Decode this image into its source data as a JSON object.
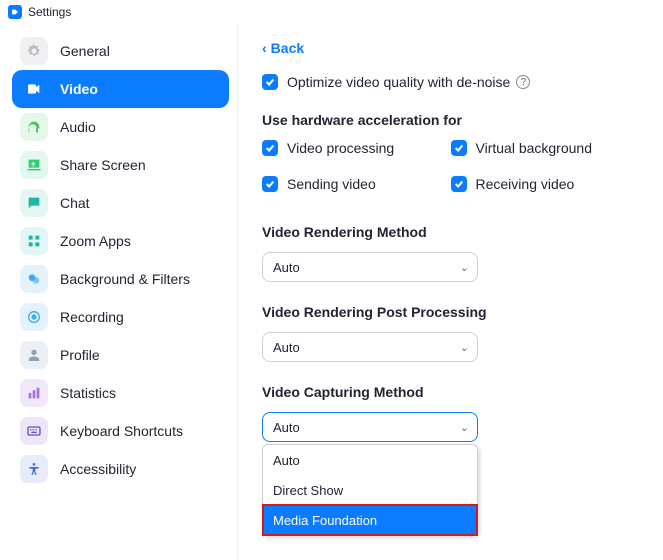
{
  "window": {
    "title": "Settings"
  },
  "sidebar": {
    "items": [
      {
        "label": "General"
      },
      {
        "label": "Video"
      },
      {
        "label": "Audio"
      },
      {
        "label": "Share Screen"
      },
      {
        "label": "Chat"
      },
      {
        "label": "Zoom Apps"
      },
      {
        "label": "Background & Filters"
      },
      {
        "label": "Recording"
      },
      {
        "label": "Profile"
      },
      {
        "label": "Statistics"
      },
      {
        "label": "Keyboard Shortcuts"
      },
      {
        "label": "Accessibility"
      }
    ]
  },
  "main": {
    "back_label": "Back",
    "optimize_label": "Optimize video quality with de-noise",
    "hwaccel_title": "Use hardware acceleration for",
    "hwaccel": {
      "video_processing": "Video processing",
      "virtual_background": "Virtual background",
      "sending_video": "Sending video",
      "receiving_video": "Receiving video"
    },
    "rendering_method_title": "Video Rendering Method",
    "rendering_method_value": "Auto",
    "post_processing_title": "Video Rendering Post Processing",
    "post_processing_value": "Auto",
    "capturing_title": "Video Capturing Method",
    "capturing_value": "Auto",
    "capturing_options": {
      "auto": "Auto",
      "direct_show": "Direct Show",
      "media_foundation": "Media Foundation"
    }
  }
}
